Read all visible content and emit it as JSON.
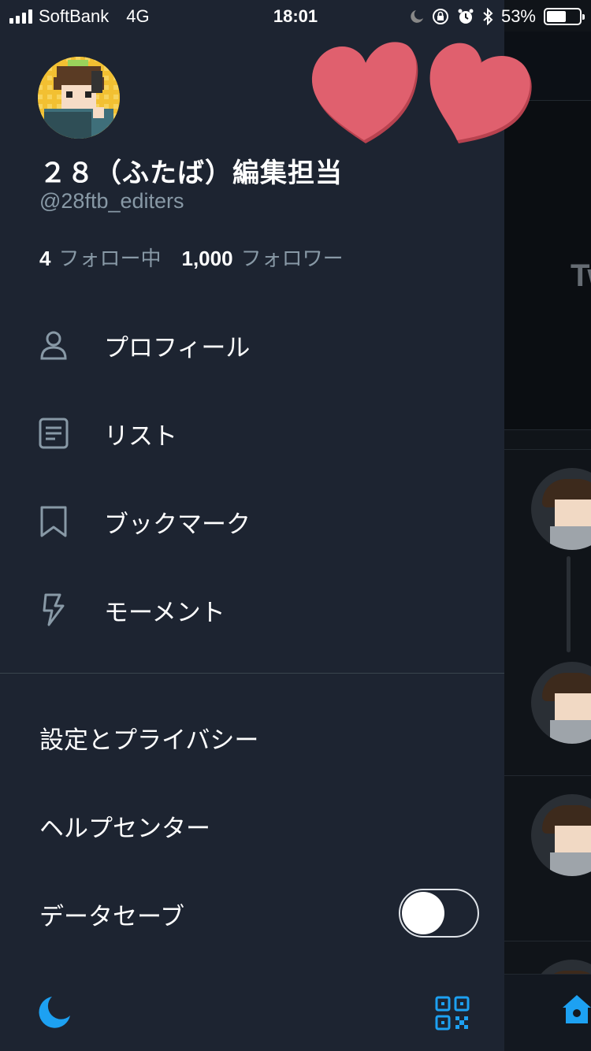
{
  "status_bar": {
    "carrier": "SoftBank",
    "network": "4G",
    "time": "18:01",
    "battery": "53%"
  },
  "profile": {
    "display_name": "２８（ふたば）編集担当",
    "handle": "@28ftb_editers",
    "following_count": "4",
    "following_label": "フォロー中",
    "followers_count": "1,000",
    "followers_label": "フォロワー"
  },
  "menu": {
    "items": [
      {
        "label": "プロフィール",
        "icon": "person-icon"
      },
      {
        "label": "リスト",
        "icon": "list-icon"
      },
      {
        "label": "ブックマーク",
        "icon": "bookmark-icon"
      },
      {
        "label": "モーメント",
        "icon": "lightning-icon"
      }
    ],
    "settings_label": "設定とプライバシー",
    "help_label": "ヘルプセンター",
    "data_saver_label": "データセーブ",
    "data_saver_on": false
  },
  "timeline": {
    "banner_text": "Tw"
  },
  "colors": {
    "drawer_bg": "#1d2431",
    "accent": "#1da1f2",
    "secondary_text": "#8899a6",
    "heart": "#e0606e"
  }
}
